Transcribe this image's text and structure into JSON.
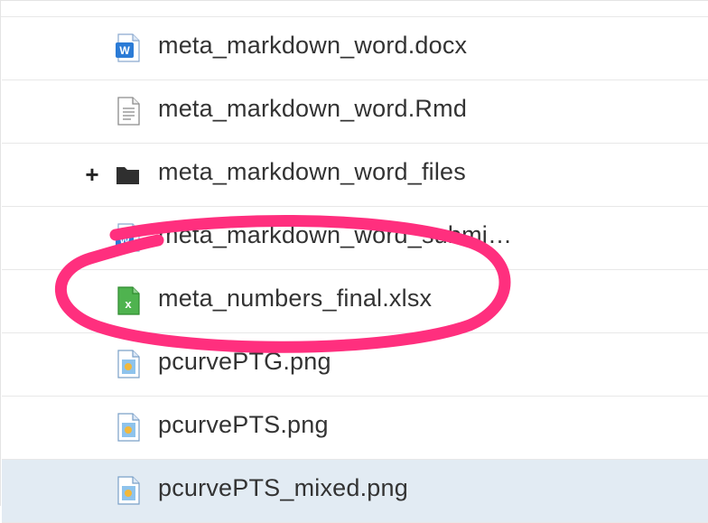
{
  "files": [
    {
      "name": "meta_markdown_word.docx",
      "icon": "word-doc-icon"
    },
    {
      "name": "meta_markdown_word.Rmd",
      "icon": "text-file-icon"
    },
    {
      "name": "meta_markdown_word_files",
      "icon": "folder-icon",
      "expander": "+"
    },
    {
      "name": "meta_markdown_word_submi…",
      "icon": "word-doc-icon"
    },
    {
      "name": "meta_numbers_final.xlsx",
      "icon": "excel-file-icon"
    },
    {
      "name": "pcurvePTG.png",
      "icon": "image-file-icon"
    },
    {
      "name": "pcurvePTS.png",
      "icon": "image-file-icon"
    },
    {
      "name": "pcurvePTS_mixed.png",
      "icon": "image-file-icon",
      "selected": true
    }
  ],
  "colors": {
    "highlight_circle": "#ff2f7e",
    "selected_row": "#e2ebf3",
    "word_blue": "#2b7bd6",
    "excel_green": "#3fa63f"
  }
}
